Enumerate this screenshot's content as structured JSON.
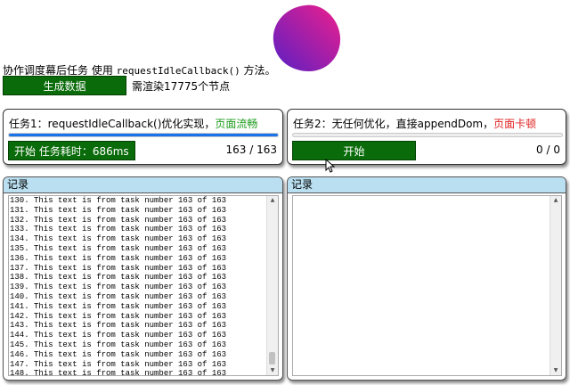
{
  "intro": {
    "prefix": "协作调度幕后任务 使用 ",
    "code": "requestIdleCallback()",
    "suffix": " 方法。"
  },
  "generate": {
    "button_label": "生成数据",
    "info": "需渲染17775个节点"
  },
  "task1": {
    "title": "任务1：requestIdleCallback()优化实现，",
    "title_highlight": "页面流畅",
    "highlight_color": "#1c9b1c",
    "progress": 1.0,
    "button_label": "开始 任务耗时：686ms",
    "count": "163 / 163"
  },
  "task2": {
    "title": "任务2：无任何优化，直接appendDom，",
    "title_highlight": "页面卡顿",
    "highlight_color": "#e02020",
    "progress": 0,
    "button_label": "开始",
    "count": "0 / 0"
  },
  "log1": {
    "header": "记录",
    "lines": [
      "130. This text is from task number 163 of 163",
      "131. This text is from task number 163 of 163",
      "132. This text is from task number 163 of 163",
      "133. This text is from task number 163 of 163",
      "134. This text is from task number 163 of 163",
      "135. This text is from task number 163 of 163",
      "136. This text is from task number 163 of 163",
      "137. This text is from task number 163 of 163",
      "138. This text is from task number 163 of 163",
      "139. This text is from task number 163 of 163",
      "140. This text is from task number 163 of 163",
      "141. This text is from task number 163 of 163",
      "142. This text is from task number 163 of 163",
      "143. This text is from task number 163 of 163",
      "144. This text is from task number 163 of 163",
      "145. This text is from task number 163 of 163",
      "146. This text is from task number 163 of 163",
      "147. This text is from task number 163 of 163",
      "148. This text is from task number 163 of 163"
    ]
  },
  "log2": {
    "header": "记录",
    "lines": []
  },
  "colors": {
    "button_green": "#0a6b0a",
    "log_header": "#b9dff0",
    "progress_blue": "#1a73e8"
  }
}
